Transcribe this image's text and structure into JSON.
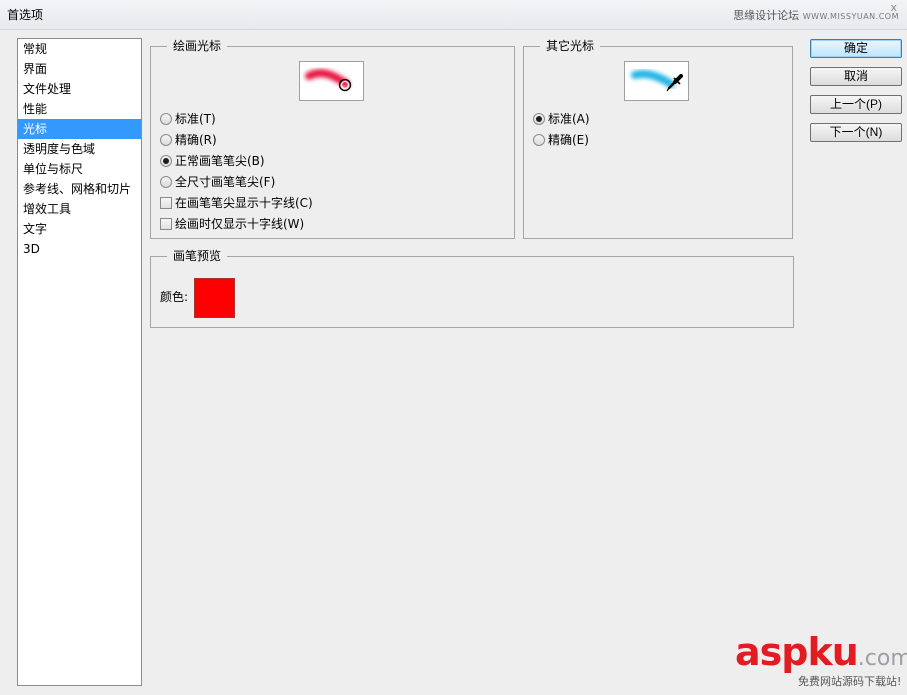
{
  "window": {
    "title": "首选项",
    "watermark_cn": "思缘设计论坛",
    "watermark_en": "WWW.MISSYUAN.COM",
    "close_glyph": "x"
  },
  "sidebar": {
    "items": [
      {
        "label": "常规"
      },
      {
        "label": "界面"
      },
      {
        "label": "文件处理"
      },
      {
        "label": "性能"
      },
      {
        "label": "光标",
        "selected": true
      },
      {
        "label": "透明度与色域"
      },
      {
        "label": "单位与标尺"
      },
      {
        "label": "参考线、网格和切片"
      },
      {
        "label": "增效工具"
      },
      {
        "label": "文字"
      },
      {
        "label": "3D"
      }
    ]
  },
  "painting_cursors": {
    "legend": "绘画光标",
    "options": [
      {
        "label": "标准(T)",
        "type": "radio",
        "checked": false
      },
      {
        "label": "精确(R)",
        "type": "radio",
        "checked": false
      },
      {
        "label": "正常画笔笔尖(B)",
        "type": "radio",
        "checked": true
      },
      {
        "label": "全尺寸画笔笔尖(F)",
        "type": "radio",
        "checked": false
      },
      {
        "label": "在画笔笔尖显示十字线(C)",
        "type": "checkbox",
        "checked": false
      },
      {
        "label": "绘画时仅显示十字线(W)",
        "type": "checkbox",
        "checked": false
      }
    ],
    "stroke_color": "#e8193f"
  },
  "other_cursors": {
    "legend": "其它光标",
    "options": [
      {
        "label": "标准(A)",
        "type": "radio",
        "checked": true
      },
      {
        "label": "精确(E)",
        "type": "radio",
        "checked": false
      }
    ],
    "stroke_color": "#22b5e6"
  },
  "brush_preview": {
    "legend": "画笔预览",
    "color_label": "颜色:",
    "color": "#ff0000"
  },
  "buttons": {
    "ok": "确定",
    "cancel": "取消",
    "prev": "上一个(P)",
    "next": "下一个(N)"
  },
  "site_watermark": {
    "brand_main": "aspku",
    "brand_suffix": ".com",
    "tagline": "免费网站源码下载站!"
  }
}
